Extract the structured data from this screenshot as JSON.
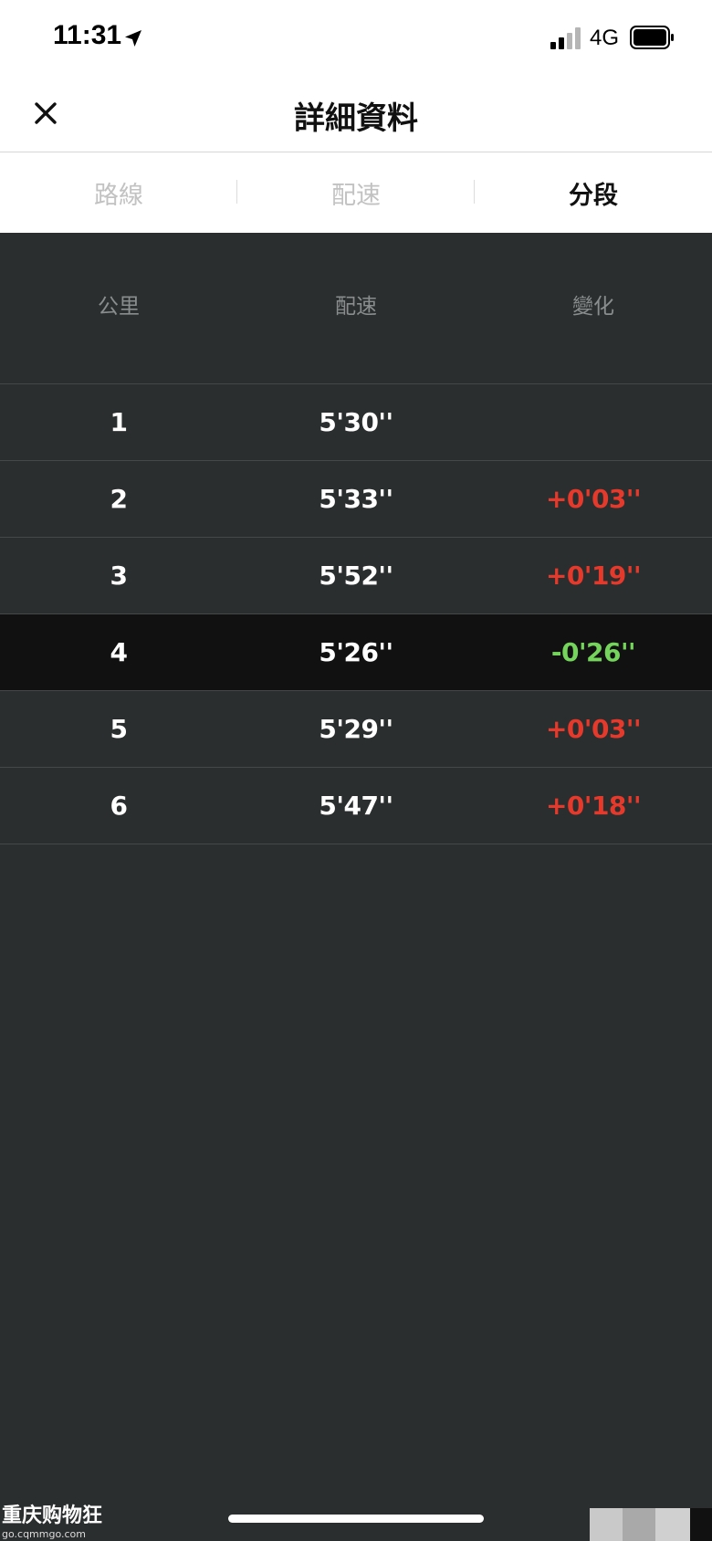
{
  "status_bar": {
    "time": "11:31",
    "network": "4G",
    "icons": [
      "location-arrow-icon",
      "cellular-signal-icon",
      "battery-icon"
    ]
  },
  "header": {
    "title": "詳細資料",
    "close_icon": "close-icon"
  },
  "tabs": [
    {
      "label": "路線",
      "active": false
    },
    {
      "label": "配速",
      "active": false
    },
    {
      "label": "分段",
      "active": true
    }
  ],
  "table": {
    "columns": [
      "公里",
      "配速",
      "變化"
    ],
    "rows": [
      {
        "km": "1",
        "pace": "5'30''",
        "change": ""
      },
      {
        "km": "2",
        "pace": "5'33''",
        "change": "+0'03''"
      },
      {
        "km": "3",
        "pace": "5'52''",
        "change": "+0'19''"
      },
      {
        "km": "4",
        "pace": "5'26''",
        "change": "-0'26''"
      },
      {
        "km": "5",
        "pace": "5'29''",
        "change": "+0'03''"
      },
      {
        "km": "6",
        "pace": "5'47''",
        "change": "+0'18''"
      }
    ],
    "highlighted_row": 4
  },
  "colors": {
    "background": "#2b2e2f",
    "highlight_row": "#111111",
    "slower": "#e5392b",
    "faster": "#75d45b"
  },
  "watermark": {
    "title": "重庆购物狂",
    "url": "go.cqmmgo.com"
  }
}
